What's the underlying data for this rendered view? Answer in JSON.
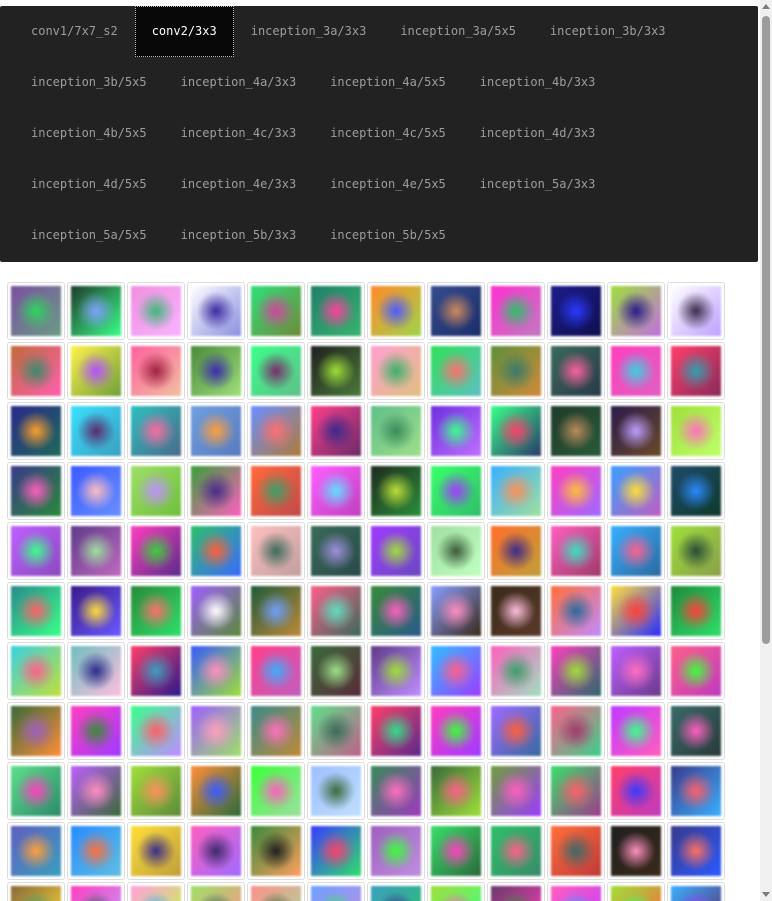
{
  "nav": {
    "tabs": [
      {
        "label": "conv1/7x7_s2",
        "active": false
      },
      {
        "label": "conv2/3x3",
        "active": true
      },
      {
        "label": "inception_3a/3x3",
        "active": false
      },
      {
        "label": "inception_3a/5x5",
        "active": false
      },
      {
        "label": "inception_3b/3x3",
        "active": false
      },
      {
        "label": "inception_3b/5x5",
        "active": false
      },
      {
        "label": "inception_4a/3x3",
        "active": false
      },
      {
        "label": "inception_4a/5x5",
        "active": false
      },
      {
        "label": "inception_4b/3x3",
        "active": false
      },
      {
        "label": "inception_4b/5x5",
        "active": false
      },
      {
        "label": "inception_4c/3x3",
        "active": false
      },
      {
        "label": "inception_4c/5x5",
        "active": false
      },
      {
        "label": "inception_4d/3x3",
        "active": false
      },
      {
        "label": "inception_4d/5x5",
        "active": false
      },
      {
        "label": "inception_4e/3x3",
        "active": false
      },
      {
        "label": "inception_4e/5x5",
        "active": false
      },
      {
        "label": "inception_5a/3x3",
        "active": false
      },
      {
        "label": "inception_5a/5x5",
        "active": false
      },
      {
        "label": "inception_5b/3x3",
        "active": false
      },
      {
        "label": "inception_5b/5x5",
        "active": false
      }
    ],
    "colors": {
      "bar": "#222222",
      "active_bg": "#080808",
      "text": "#9d9d9d",
      "active_text": "#ffffff"
    }
  },
  "gallery": {
    "columns": 12,
    "tiles": [
      [
        "#7b4fa0",
        "#2fd45c",
        "#6a9c86"
      ],
      [
        "#1f3b2a",
        "#7fa1ff",
        "#3aff8a"
      ],
      [
        "#f08fe0",
        "#3fb87a",
        "#f9b3ff"
      ],
      [
        "#ffffff",
        "#3a2aa0",
        "#8a8fe0"
      ],
      [
        "#2fe07a",
        "#d0459f",
        "#6f8a3a"
      ],
      [
        "#1f7f6a",
        "#ff3f9c",
        "#39b36e"
      ],
      [
        "#ff8a2a",
        "#4a5aff",
        "#a0d44a"
      ],
      [
        "#364c8c",
        "#d08a5a",
        "#1c2e6a"
      ],
      [
        "#ff30d0",
        "#2fbf6a",
        "#c07ac0"
      ],
      [
        "#1c1c8a",
        "#2a3aff",
        "#0f0f50"
      ],
      [
        "#9fdf3a",
        "#2a1a8a",
        "#c06fe0"
      ],
      [
        "#ffffff",
        "#3a2a4a",
        "#c0a0ff"
      ],
      [
        "#bf6a3a",
        "#3a8a6a",
        "#ff60b0"
      ],
      [
        "#fff24a",
        "#b04fff",
        "#6f9f3a"
      ],
      [
        "#ff60a0",
        "#a02040",
        "#f0c0a0"
      ],
      [
        "#4a8a3a",
        "#3a2aaf",
        "#9fdf7a"
      ],
      [
        "#3aff8a",
        "#7a2a6a",
        "#5fbf8a"
      ],
      [
        "#1f1f1f",
        "#9fdf3a",
        "#4a7a3a"
      ],
      [
        "#ff9fd0",
        "#3ab06a",
        "#e0c080"
      ],
      [
        "#2fe05a",
        "#ff6f6f",
        "#5fbfbf"
      ],
      [
        "#5f8f3a",
        "#3a7a6a",
        "#d08a3a"
      ],
      [
        "#3a6a5a",
        "#ff60a0",
        "#2a3a4a"
      ],
      [
        "#ff3fbf",
        "#3ad0e0",
        "#e060c0"
      ],
      [
        "#ff3f6a",
        "#2f9faf",
        "#8a2a5a"
      ],
      [
        "#2a2a8a",
        "#ff9f2a",
        "#1f6a5a"
      ],
      [
        "#3ae0ff",
        "#5a2a6a",
        "#3a9fbf"
      ],
      [
        "#2fbfbf",
        "#ff6a9f",
        "#4a6a8a"
      ],
      [
        "#6f9fdf",
        "#ff9f3a",
        "#5a7ac0"
      ],
      [
        "#6a8fff",
        "#ff6f6f",
        "#b07a3a"
      ],
      [
        "#ff3f8a",
        "#3a2a8a",
        "#6a2a6a"
      ],
      [
        "#5fbf8a",
        "#3a8a5a",
        "#9fdf8a"
      ],
      [
        "#6f2fdf",
        "#3aff8a",
        "#bf6fff"
      ],
      [
        "#3aff8a",
        "#ff3f6a",
        "#2a3a6a"
      ],
      [
        "#1f3a2a",
        "#bf8a5a",
        "#2a5a3a"
      ],
      [
        "#2a1a4a",
        "#bf9fff",
        "#6a4a2a"
      ],
      [
        "#9fdf3a",
        "#ff6fbf",
        "#c0ff6a"
      ],
      [
        "#3a3a8a",
        "#ff5fbf",
        "#2a8a3a"
      ],
      [
        "#3a5aff",
        "#ffbfbf",
        "#6a8fff"
      ],
      [
        "#9fdf6a",
        "#bf8fff",
        "#6fbf3a"
      ],
      [
        "#3a9f3a",
        "#4a2a8a",
        "#ff5fbf"
      ],
      [
        "#ff6a3a",
        "#3a9f6a",
        "#bf4a4a"
      ],
      [
        "#ff5fff",
        "#5fdfff",
        "#bf3fbf"
      ],
      [
        "#1f2a1f",
        "#bfdf3a",
        "#2a8f3a"
      ],
      [
        "#3aff6a",
        "#9f3aff",
        "#2fbf6a"
      ],
      [
        "#3aafff",
        "#ff8f5a",
        "#9fdf9f"
      ],
      [
        "#ff3fbf",
        "#ffbf3a",
        "#9f6aff"
      ],
      [
        "#3a9fff",
        "#ffdf3a",
        "#bf5fbf"
      ],
      [
        "#1f4a6a",
        "#2a8aff",
        "#0f3a2a"
      ],
      [
        "#bf5fff",
        "#3aff8a",
        "#8a4abf"
      ],
      [
        "#5f3a8a",
        "#9fdf9f",
        "#bf6abf"
      ],
      [
        "#ff3fbf",
        "#3ad03a",
        "#5a2a8a"
      ],
      [
        "#2fbf6a",
        "#ff5f3a",
        "#3a6aff"
      ],
      [
        "#ffbfbf",
        "#3a6a5a",
        "#c09f9f"
      ],
      [
        "#3a6a5a",
        "#9f8fdf",
        "#2a4a4a"
      ],
      [
        "#9f3aff",
        "#9fdf3a",
        "#6a4abf"
      ],
      [
        "#9fdf9f",
        "#3a5a3a",
        "#bfffbf"
      ],
      [
        "#ff6f2a",
        "#3a2a8a",
        "#bf9f3a"
      ],
      [
        "#ff5fbf",
        "#3adfbf",
        "#9f3a6a"
      ],
      [
        "#3aafff",
        "#ff5f8f",
        "#2a6a9f"
      ],
      [
        "#9fdf3a",
        "#2a4a3a",
        "#8a9f4a"
      ],
      [
        "#2a8a8a",
        "#ff5f6a",
        "#3aff8a"
      ],
      [
        "#3a1a8a",
        "#ffdf3a",
        "#6a5aff"
      ],
      [
        "#2a8a3a",
        "#ff6f6a",
        "#2fdf6a"
      ],
      [
        "#9f5fff",
        "#ffffff",
        "#5a8a3a"
      ],
      [
        "#1f5a3a",
        "#6f9fff",
        "#bf8a3a"
      ],
      [
        "#ff5f8a",
        "#5fdfbf",
        "#3a6a5a"
      ],
      [
        "#3a8a3a",
        "#ff5fbf",
        "#2a5a8a"
      ],
      [
        "#8a9fff",
        "#ff8fbf",
        "#3a2a1a"
      ],
      [
        "#3a2a1a",
        "#ffbfdf",
        "#5a3a2a"
      ],
      [
        "#ff6f3a",
        "#2a6a9f",
        "#bf8aff"
      ],
      [
        "#ffdf3a",
        "#ff3f3a",
        "#2a2aff"
      ],
      [
        "#1f8a3a",
        "#ff3f3a",
        "#2fdf6a"
      ],
      [
        "#3ad0e0",
        "#ff5f8a",
        "#bfdf3a"
      ],
      [
        "#6fbfbf",
        "#2a2a8a",
        "#ffbfdf"
      ],
      [
        "#ff3f6a",
        "#3a9fbf",
        "#2a1a8a"
      ],
      [
        "#3a5aff",
        "#ff8fbf",
        "#9fdf3a"
      ],
      [
        "#ff3f8a",
        "#3aafff",
        "#bf5fbf"
      ],
      [
        "#3a6a3a",
        "#9fdf8a",
        "#5a2a3a"
      ],
      [
        "#5f3a8a",
        "#9fdf3a",
        "#bf8fff"
      ],
      [
        "#2fbfff",
        "#ff5f8a",
        "#9f3aff"
      ],
      [
        "#ff5fbf",
        "#3a9f6a",
        "#9fdfbf"
      ],
      [
        "#ff3fbf",
        "#9fdf3a",
        "#2a6a6a"
      ],
      [
        "#bf5fff",
        "#ff6fbf",
        "#6a3a8a"
      ],
      [
        "#ff5f8a",
        "#3aff3a",
        "#bf3abf"
      ],
      [
        "#3a6a3a",
        "#9f5fbf",
        "#ff8f3a"
      ],
      [
        "#ff3fbf",
        "#3a8a3a",
        "#9f3aff"
      ],
      [
        "#3aff8a",
        "#ff5f6a",
        "#bf8aff"
      ],
      [
        "#9f5fff",
        "#ff9fbf",
        "#9fdf6a"
      ],
      [
        "#3a8a8a",
        "#ff6fbf",
        "#bf8a3a"
      ],
      [
        "#5fdf8a",
        "#3a6a5a",
        "#bf5f8a"
      ],
      [
        "#ff3f6a",
        "#2fdf8a",
        "#5a2a8a"
      ],
      [
        "#ff3fbf",
        "#3aff3a",
        "#9f3aff"
      ],
      [
        "#9f6aff",
        "#ff5f3a",
        "#3a6a9f"
      ],
      [
        "#ff5f8a",
        "#9f3a6a",
        "#3ad08a"
      ],
      [
        "#bf3aff",
        "#3aff8a",
        "#ff5fbf"
      ],
      [
        "#3a6a6a",
        "#ff5fbf",
        "#2a3a3a"
      ],
      [
        "#5fdf8a",
        "#ff3fbf",
        "#2a8a6a"
      ],
      [
        "#bf5fff",
        "#ff8fbf",
        "#3a6a3a"
      ],
      [
        "#9fdf3a",
        "#ff8f5f",
        "#5f8a3a"
      ],
      [
        "#ff8f3a",
        "#3a5aff",
        "#2a6a3a"
      ],
      [
        "#3aff3a",
        "#ff5fbf",
        "#9fdf9f"
      ],
      [
        "#9fbfff",
        "#3a6a3a",
        "#bfdfff"
      ],
      [
        "#3a8a5a",
        "#ff6fbf",
        "#9f3abf"
      ],
      [
        "#3a6a3a",
        "#ff5f8a",
        "#9fdf3a"
      ],
      [
        "#6f9f3a",
        "#ff5fbf",
        "#9f3aff"
      ],
      [
        "#3adf6a",
        "#ff5f6a",
        "#9f3a8a"
      ],
      [
        "#ff3f6a",
        "#3a3aff",
        "#bf3abf"
      ],
      [
        "#3a3a8a",
        "#ff5f6a",
        "#3aafff"
      ],
      [
        "#5f5fbf",
        "#ff9f3a",
        "#3a9fbf"
      ],
      [
        "#2a8aff",
        "#ff6f3a",
        "#5fbfdf"
      ],
      [
        "#ffdf3a",
        "#3a2a8a",
        "#bf9f3a"
      ],
      [
        "#ff5fbf",
        "#3a2a6a",
        "#9f6aff"
      ],
      [
        "#3a8a3a",
        "#1f1f1f",
        "#ff9f5f"
      ],
      [
        "#3a3aff",
        "#ff3f6a",
        "#2fdf6a"
      ],
      [
        "#9f5fbf",
        "#3aff3a",
        "#bf8fdf"
      ],
      [
        "#3adf6a",
        "#ff3fbf",
        "#2a6a3a"
      ],
      [
        "#2fbf6a",
        "#ff5f8a",
        "#3a8a6a"
      ],
      [
        "#ff6f3a",
        "#3a6a6a",
        "#bf3a3a"
      ],
      [
        "#1f1f1f",
        "#ff8fbf",
        "#3a2a1a"
      ],
      [
        "#3a3a8a",
        "#ff6f5f",
        "#2a5aff"
      ],
      [
        "#8a6a3a",
        "#3a9f6a",
        "#ffdf3a"
      ],
      [
        "#ff3fbf",
        "#3a5a6a",
        "#bf9fff"
      ],
      [
        "#ff9fdf",
        "#3aafff",
        "#bfff3a"
      ],
      [
        "#9fdf6a",
        "#3a6a5a",
        "#ff8f8a"
      ],
      [
        "#ff8f8a",
        "#3a6a3a",
        "#9fdf9f"
      ],
      [
        "#6f9fff",
        "#3adf6a",
        "#bf8fdf"
      ],
      [
        "#3a9fbf",
        "#3a2a8a",
        "#2fbf6a"
      ],
      [
        "#9fdf3a",
        "#ff5fbf",
        "#3aff8a"
      ],
      [
        "#6a3a6a",
        "#3a8a3a",
        "#ff3fbf"
      ],
      [
        "#ff5fbf",
        "#3a9fff",
        "#bf3aff"
      ],
      [
        "#9fdf3a",
        "#3aff6a",
        "#ff5f3a"
      ],
      [
        "#3aafff",
        "#9f3aff",
        "#5a2a6a"
      ]
    ]
  }
}
